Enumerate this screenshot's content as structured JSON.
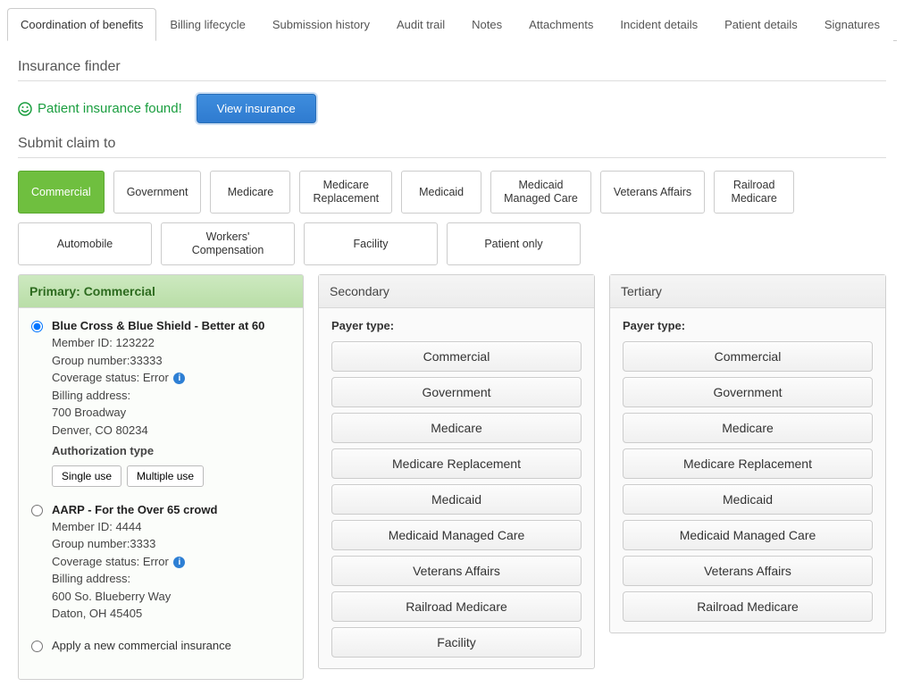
{
  "tabs": [
    "Coordination of benefits",
    "Billing lifecycle",
    "Submission history",
    "Audit trail",
    "Notes",
    "Attachments",
    "Incident details",
    "Patient details",
    "Signatures"
  ],
  "active_tab_index": 0,
  "finder": {
    "title": "Insurance finder",
    "found_text": "Patient insurance found!",
    "view_button": "View insurance"
  },
  "submit": {
    "title": "Submit claim to",
    "row1": [
      "Commercial",
      "Government",
      "Medicare",
      "Medicare Replacement",
      "Medicaid",
      "Medicaid Managed Care",
      "Veterans Affairs",
      "Railroad Medicare"
    ],
    "row2": [
      "Automobile",
      "Workers' Compensation",
      "Facility",
      "Patient only"
    ],
    "active": "Commercial"
  },
  "primary": {
    "header": "Primary: Commercial",
    "options": [
      {
        "selected": true,
        "title": "Blue Cross & Blue Shield - Better at 60",
        "member_id": "Member ID: 123222",
        "group": "Group number:33333",
        "coverage": "Coverage status: Error",
        "billing_label": "Billing address:",
        "addr1": "700 Broadway",
        "addr2": "Denver, CO 80234",
        "auth_label": "Authorization type",
        "auth_buttons": [
          "Single use",
          "Multiple use"
        ]
      },
      {
        "selected": false,
        "title": "AARP - For the Over 65 crowd",
        "member_id": "Member ID: 4444",
        "group": "Group number:3333",
        "coverage": "Coverage status: Error",
        "billing_label": "Billing address:",
        "addr1": "600 So. Blueberry Way",
        "addr2": "Daton, OH 45405"
      }
    ],
    "apply_new": "Apply a new commercial insurance"
  },
  "secondary": {
    "header": "Secondary",
    "payer_label": "Payer type:",
    "buttons": [
      "Commercial",
      "Government",
      "Medicare",
      "Medicare Replacement",
      "Medicaid",
      "Medicaid Managed Care",
      "Veterans Affairs",
      "Railroad Medicare",
      "Facility"
    ]
  },
  "tertiary": {
    "header": "Tertiary",
    "payer_label": "Payer type:",
    "buttons": [
      "Commercial",
      "Government",
      "Medicare",
      "Medicare Replacement",
      "Medicaid",
      "Medicaid Managed Care",
      "Veterans Affairs",
      "Railroad Medicare"
    ]
  }
}
